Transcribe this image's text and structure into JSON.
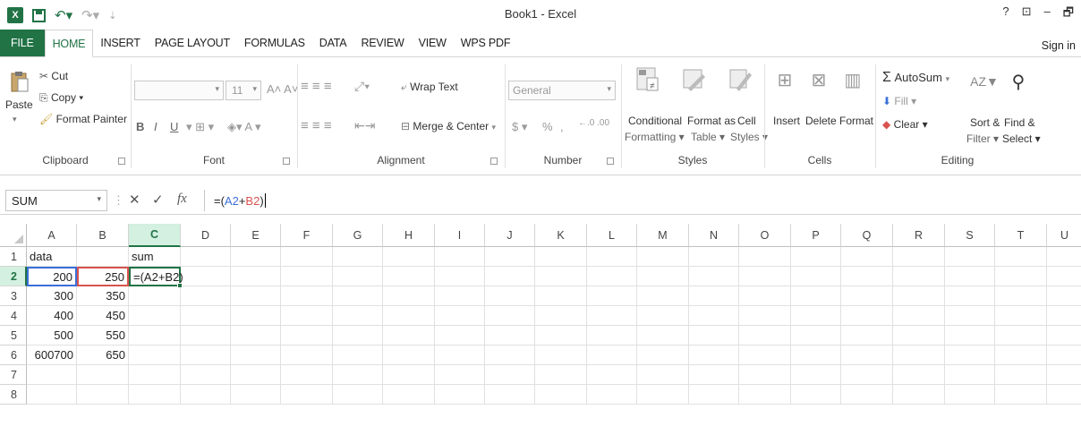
{
  "app": {
    "title": "Book1 - Excel",
    "logo": "X",
    "help": "?",
    "restore": "⊡",
    "minimize": "–",
    "maximize": "🗗"
  },
  "quick_access": {
    "undo_icon": "undo-icon",
    "redo_icon": "redo-icon"
  },
  "tabs": [
    "FILE",
    "HOME",
    "INSERT",
    "PAGE LAYOUT",
    "FORMULAS",
    "DATA",
    "REVIEW",
    "VIEW",
    "WPS PDF"
  ],
  "active_tab": "HOME",
  "sign_in": "Sign in",
  "ribbon": {
    "clipboard": {
      "label": "Clipboard",
      "paste": "Paste",
      "cut": "Cut",
      "copy": "Copy ▾",
      "format_painter": "Format Painter"
    },
    "font": {
      "label": "Font",
      "font_name": "",
      "font_size": "11",
      "bold": "B",
      "italic": "I",
      "underline": "U"
    },
    "alignment": {
      "label": "Alignment",
      "wrap_text": "Wrap Text",
      "merge_center": "Merge & Center"
    },
    "number": {
      "label": "Number",
      "format": "General",
      "currency": "$",
      "percent": "%",
      "comma": ","
    },
    "styles": {
      "label": "Styles",
      "conditional": "Conditional",
      "formatting": "Formatting ▾",
      "format_as": "Format as",
      "table": "Table ▾",
      "cell": "Cell",
      "cell_styles": "Styles ▾"
    },
    "cells": {
      "label": "Cells",
      "insert": "Insert",
      "delete": "Delete",
      "format": "Format"
    },
    "editing": {
      "label": "Editing",
      "autosum": "AutoSum",
      "fill": "Fill ▾",
      "clear": "Clear ▾",
      "sort": "Sort &",
      "filter": "Filter ▾",
      "find": "Find &",
      "select": "Select ▾"
    }
  },
  "formula_bar": {
    "name_box": "SUM",
    "cancel": "✕",
    "enter": "✓",
    "fx": "fx",
    "formula_prefix": "=(",
    "ref_a": "A2",
    "plus": "+",
    "ref_b": "B2",
    "formula_suffix": ")"
  },
  "sheet": {
    "columns": [
      "A",
      "B",
      "C",
      "D",
      "E",
      "F",
      "G",
      "H",
      "I",
      "J",
      "K",
      "L",
      "M",
      "N",
      "O",
      "P",
      "Q",
      "R",
      "S",
      "T",
      "U"
    ],
    "selected_column": "C",
    "selected_row": 2,
    "rows": [
      {
        "n": "1",
        "a": "data",
        "b": "",
        "c": "sum"
      },
      {
        "n": "2",
        "a": "200",
        "b": "250",
        "c": "=(A2+B2)"
      },
      {
        "n": "3",
        "a": "300",
        "b": "350",
        "c": ""
      },
      {
        "n": "4",
        "a": "400",
        "b": "450",
        "c": ""
      },
      {
        "n": "5",
        "a": "500",
        "b": "550",
        "c": ""
      },
      {
        "n": "6",
        "a": "600700",
        "b": "650",
        "c": ""
      },
      {
        "n": "7",
        "a": "",
        "b": "",
        "c": ""
      },
      {
        "n": "8",
        "a": "",
        "b": "",
        "c": ""
      }
    ]
  },
  "colors": {
    "excel_green": "#217346",
    "ref_a": "#3a6fd8",
    "ref_b": "#d9534f"
  }
}
